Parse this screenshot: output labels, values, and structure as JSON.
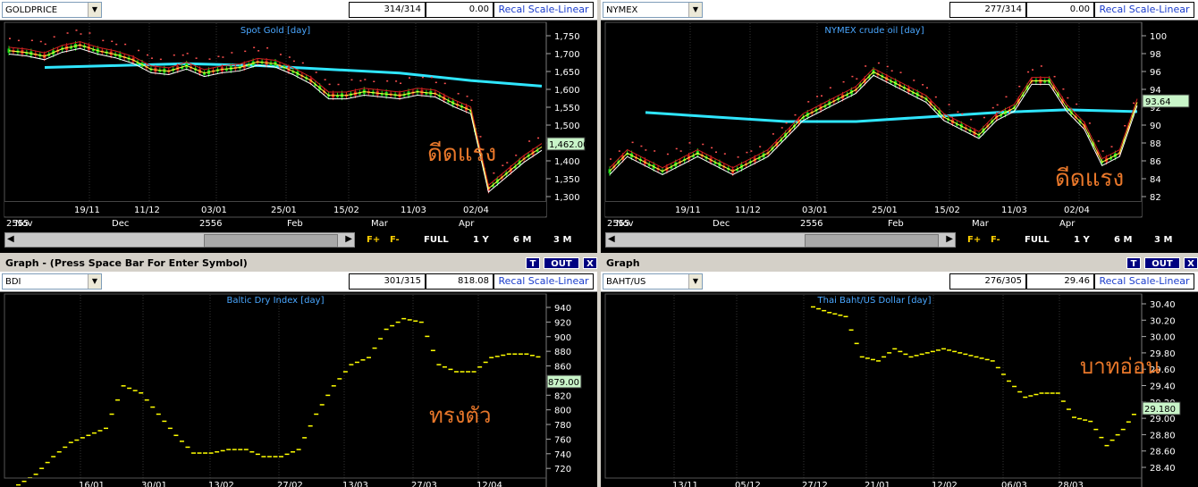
{
  "panels": [
    {
      "id": "gold",
      "symbol": "GOLDPRICE",
      "count": "314/314",
      "change": "0.00",
      "recal": "Recal Scale-Linear",
      "chart_title": "Spot Gold [day]",
      "annotation": "ดีดแรง",
      "last_value": "1,462.00",
      "y_ticks": [
        "1,750",
        "1,700",
        "1,650",
        "1,600",
        "1,550",
        "1,500",
        "1,450",
        "1,400",
        "1,350",
        "1,300"
      ],
      "date_ticks": [
        "19/11",
        "11/12",
        "03/01",
        "25/01",
        "15/02",
        "11/03",
        "02/04"
      ],
      "month_ticks": [
        "2555",
        "Nov",
        "Dec",
        "2556",
        "Feb",
        "Mar",
        "Apr"
      ],
      "nav": [
        "F+",
        "F-",
        "FULL",
        "1 Y",
        "6 M",
        "3 M"
      ]
    },
    {
      "id": "nymex",
      "symbol": "NYMEX",
      "count": "277/314",
      "change": "0.00",
      "recal": "Recal Scale-Linear",
      "chart_title": "NYMEX crude oil [day]",
      "annotation": "ดีดแรง",
      "last_value": "93.64",
      "y_ticks": [
        "100",
        "98",
        "96",
        "94",
        "92",
        "90",
        "88",
        "86",
        "84",
        "82"
      ],
      "date_ticks": [
        "19/11",
        "11/12",
        "03/01",
        "25/01",
        "15/02",
        "11/03",
        "02/04"
      ],
      "month_ticks": [
        "2555",
        "Nov",
        "Dec",
        "2556",
        "Feb",
        "Mar",
        "Apr"
      ],
      "nav": [
        "F+",
        "F-",
        "FULL",
        "1 Y",
        "6 M",
        "3 M"
      ]
    },
    {
      "id": "bdi",
      "window_title": "Graph  - (Press Space Bar For Enter Symbol)",
      "symbol": "BDI",
      "count": "301/315",
      "change": "818.08",
      "recal": "Recal Scale-Linear",
      "chart_title": "Baltic Dry Index [day]",
      "annotation": "ทรงตัว",
      "last_value": "879.00",
      "y_ticks": [
        "940",
        "920",
        "900",
        "880",
        "860",
        "840",
        "820",
        "800",
        "780",
        "760",
        "740",
        "720"
      ],
      "date_ticks": [
        "16/01",
        "30/01",
        "13/02",
        "27/02",
        "13/03",
        "27/03",
        "12/04"
      ],
      "buttons": [
        "T",
        "OUT",
        "X"
      ]
    },
    {
      "id": "baht",
      "window_title": "Graph",
      "symbol": "BAHT/US",
      "count": "276/305",
      "change": "29.46",
      "recal": "Recal Scale-Linear",
      "chart_title": "Thai Baht/US Dollar [day]",
      "annotation": "บาทอ่อน",
      "last_value": "29.180",
      "y_ticks": [
        "30.40",
        "30.20",
        "30.00",
        "29.80",
        "29.60",
        "29.40",
        "29.20",
        "29.00",
        "28.80",
        "28.60",
        "28.40"
      ],
      "date_ticks": [
        "13/11",
        "05/12",
        "27/12",
        "21/01",
        "12/02",
        "06/03",
        "28/03"
      ],
      "buttons": [
        "T",
        "OUT",
        "X"
      ]
    }
  ],
  "chart_data": [
    {
      "type": "line",
      "title": "Spot Gold [day]",
      "ylim": [
        1300,
        1760
      ],
      "series": [
        {
          "values": [
            1720,
            1715,
            1705,
            1725,
            1735,
            1720,
            1710,
            1695,
            1670,
            1665,
            1680,
            1660,
            1670,
            1675,
            1690,
            1685,
            1665,
            1640,
            1600,
            1600,
            1610,
            1605,
            1600,
            1610,
            1605,
            1580,
            1560,
            1350,
            1390,
            1430,
            1462
          ]
        }
      ]
    },
    {
      "type": "line",
      "title": "NYMEX crude oil [day]",
      "ylim": [
        82,
        101
      ],
      "series": [
        {
          "values": [
            86,
            88,
            87,
            86,
            87,
            88,
            87,
            86,
            87,
            88,
            90,
            92,
            93,
            94,
            95,
            97,
            96,
            95,
            94,
            92,
            91,
            90,
            92,
            93,
            96,
            96,
            93,
            91,
            87,
            88,
            93.64
          ]
        }
      ]
    },
    {
      "type": "scatter",
      "title": "Baltic Dry Index [day]",
      "ylim": [
        710,
        950
      ],
      "series": [
        {
          "values": [
            700,
            715,
            740,
            760,
            770,
            780,
            840,
            830,
            800,
            770,
            745,
            745,
            750,
            750,
            740,
            740,
            750,
            800,
            840,
            870,
            880,
            920,
            935,
            930,
            870,
            860,
            860,
            880,
            885,
            885,
            879
          ]
        }
      ]
    },
    {
      "type": "scatter",
      "title": "Thai Baht/US Dollar [day]",
      "ylim": [
        28.3,
        30.45
      ],
      "series": [
        {
          "values": [
            30.42,
            30.35,
            30.3,
            29.8,
            29.75,
            29.9,
            29.8,
            29.85,
            29.9,
            29.85,
            29.8,
            29.75,
            29.5,
            29.3,
            29.35,
            29.35,
            29.05,
            29.0,
            28.7,
            28.9,
            29.18
          ]
        }
      ]
    }
  ]
}
